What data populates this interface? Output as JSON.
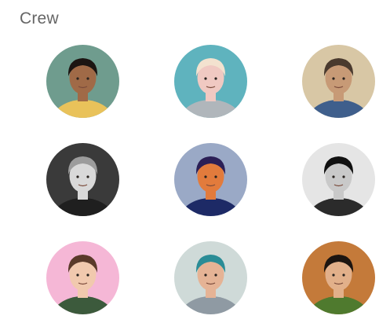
{
  "crew": {
    "title": "Crew",
    "members": [
      {
        "avatar": "avatar-photo-man-curly-hair-colorful-shirt",
        "bg": "#6f9c8e",
        "skin": "#a06a47",
        "hair": "#1c1512",
        "shirt": "#e9c25a"
      },
      {
        "avatar": "avatar-photo-woman-cat-ears-holding-cat",
        "bg": "#5fb3be",
        "skin": "#f0c9c2",
        "hair": "#f3e2cf",
        "shirt": "#b0b6bb"
      },
      {
        "avatar": "avatar-photo-man-costume-blue-armor",
        "bg": "#d8c7a5",
        "skin": "#c79a76",
        "hair": "#4a3a2e",
        "shirt": "#3f5f8c"
      },
      {
        "avatar": "avatar-photo-man-hood-black-white",
        "bg": "#3a3a3a",
        "skin": "#d9d9d9",
        "hair": "#9c9c9c",
        "shirt": "#1f1f1f"
      },
      {
        "avatar": "avatar-illustration-man-low-poly",
        "bg": "#9aa9c6",
        "skin": "#e27b3c",
        "hair": "#2b1f56",
        "shirt": "#1d2a66"
      },
      {
        "avatar": "avatar-photo-man-black-cap-glasses",
        "bg": "#e5e5e5",
        "skin": "#c9c9c9",
        "hair": "#111111",
        "shirt": "#2b2b2b"
      },
      {
        "avatar": "avatar-photo-woman-pink-background",
        "bg": "#f5b7d6",
        "skin": "#f1c9ae",
        "hair": "#5a3a2a",
        "shirt": "#3c5a3c"
      },
      {
        "avatar": "avatar-photo-man-teal-cap",
        "bg": "#cfdad8",
        "skin": "#e5b395",
        "hair": "#2a8c96",
        "shirt": "#8f9aa3"
      },
      {
        "avatar": "avatar-photo-man-green-jacket",
        "bg": "#c47a3a",
        "skin": "#e2b08a",
        "hair": "#1d1510",
        "shirt": "#4f7a2e"
      }
    ]
  }
}
